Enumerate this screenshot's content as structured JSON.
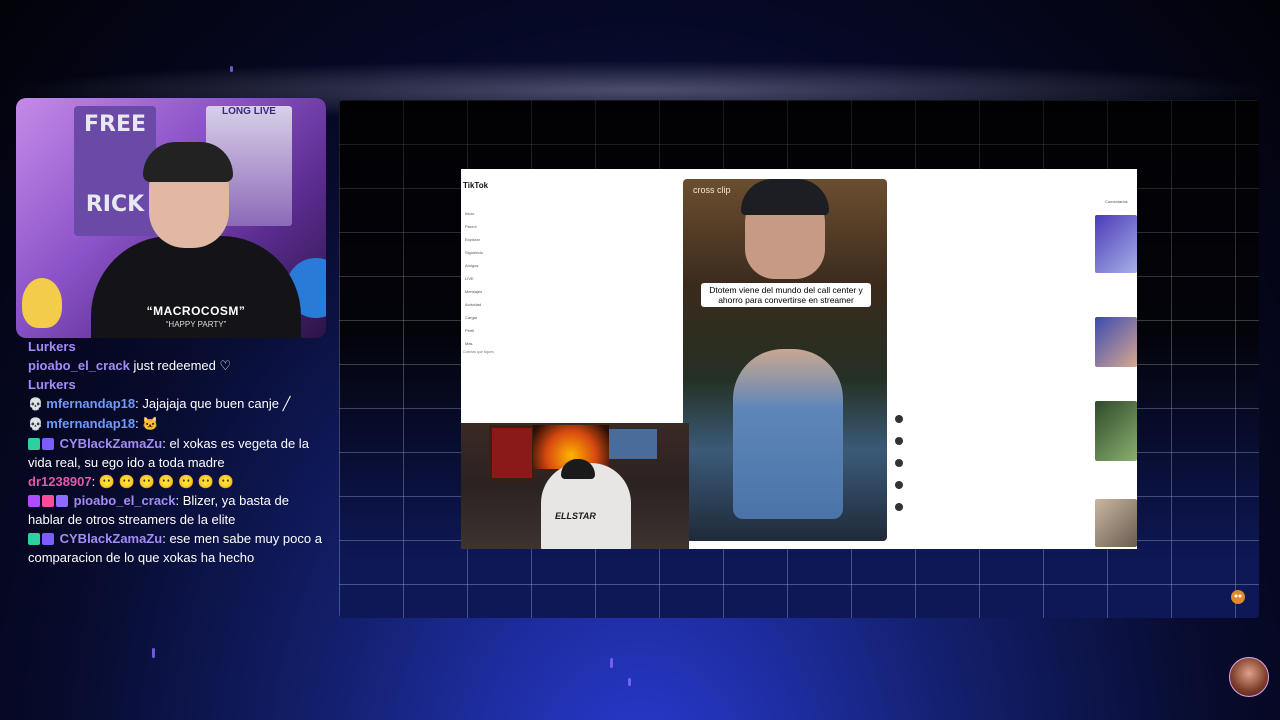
{
  "webcam": {
    "poster_line1": "FREE",
    "poster_line2": "RICK",
    "poster_right": "LONG LIVE",
    "hoodie_text": "“MACROCOSM”",
    "hoodie_sub": "“HAPPY PARTY”"
  },
  "chat": {
    "lines": [
      {
        "type": "lurkers",
        "text": "Lurkers"
      },
      {
        "user": "pioabo_el_crack",
        "user_color": "#a58bf6",
        "text": " just redeemed ♡"
      },
      {
        "type": "lurkers",
        "text": "Lurkers"
      },
      {
        "user": "mfernandap18",
        "user_color": "#6e9bff",
        "text": ": Jajajaja que buen canje ╱",
        "badge": "skull"
      },
      {
        "user": "mfernandap18",
        "user_color": "#6e9bff",
        "text": ": 🐱",
        "badge": "skull"
      },
      {
        "user": "CYBlackZamaZu",
        "user_color": "#a58bf6",
        "text": ": el xokas es vegeta de la vida real, su ego ido a toda madre",
        "badge": "gem"
      },
      {
        "user": "dr1238907",
        "user_color": "#e45aa8",
        "text": ": 😶 😶 😶 😶 😶 😶 😶"
      },
      {
        "user": "pioabo_el_crack",
        "user_color": "#a58bf6",
        "text": ": Blizer, ya basta de hablar de otros streamers de la elite",
        "badge": "heart"
      },
      {
        "user": "CYBlackZamaZu",
        "user_color": "#a58bf6",
        "text": ": ese men sabe muy poco a comparacion de lo que xokas ha hecho",
        "badge": "gem"
      }
    ]
  },
  "tiktok": {
    "logo": "TikTok",
    "nav": [
      "Inicio",
      "Para ti",
      "Explorar",
      "Siguiendo",
      "Amigos",
      "LIVE",
      "Mensajes",
      "Actividad",
      "Cargar",
      "Perfil",
      "Más"
    ],
    "following_title": "Cuentas que sigues",
    "clip_tag": "cross clip",
    "caption": "Dtotem viene del mundo del call center y ahorro para convertirse en streamer",
    "right_title": "Comentarios",
    "cam_shirt": "ELLSTAR"
  },
  "colors": {
    "accent": "#a58bf6",
    "user_blue": "#6e9bff",
    "user_pink": "#e45aa8",
    "grid_blue": "#2a3bd6"
  }
}
